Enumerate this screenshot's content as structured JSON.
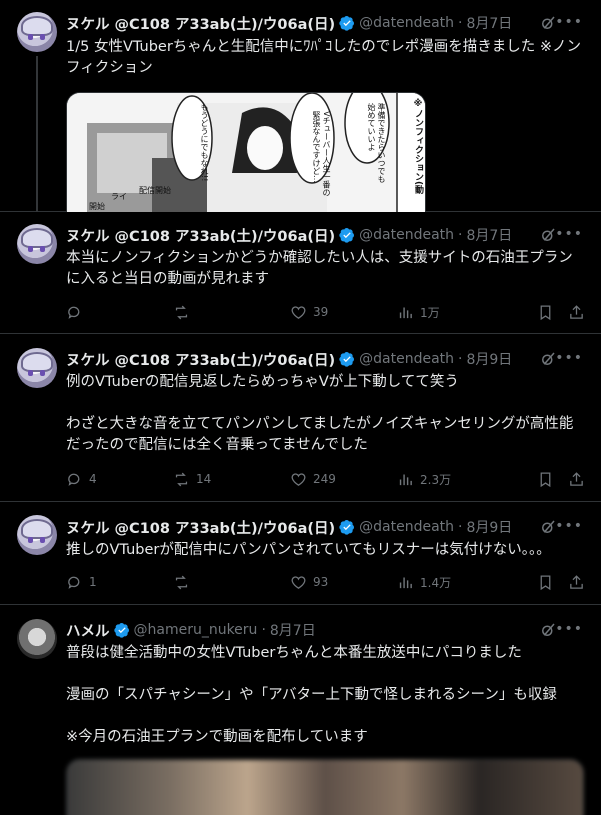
{
  "tweets": [
    {
      "name": "ヌケル @C108 ア33ab(土)/ウ06a(日)",
      "handle": "@datendeath",
      "dot": "·",
      "date": "8月7日",
      "text": "1/5 女性VTuberちゃんと生配信中にﾜﾊﾟｺしたのでレポ漫画を描きました ※ノンフィクション"
    },
    {
      "name": "ヌケル @C108 ア33ab(土)/ウ06a(日)",
      "handle": "@datendeath",
      "dot": "·",
      "date": "8月7日",
      "text": "本当にノンフィクションかどうか確認したい人は、支援サイトの石油王プランに入ると当日の動画が見れます",
      "replies": "",
      "retweets": "",
      "likes": "39",
      "views": "1万"
    },
    {
      "name": "ヌケル @C108 ア33ab(土)/ウ06a(日)",
      "handle": "@datendeath",
      "dot": "·",
      "date": "8月9日",
      "text": "例のVTuberの配信見返したらめっちゃVが上下動してて笑う\n\nわざと大きな音を立ててパンパンしてましたがノイズキャンセリングが高性能だったので配信には全く音乗ってませんでした",
      "replies": "4",
      "retweets": "14",
      "likes": "249",
      "views": "2.3万"
    },
    {
      "name": "ヌケル @C108 ア33ab(土)/ウ06a(日)",
      "handle": "@datendeath",
      "dot": "·",
      "date": "8月9日",
      "text": "推しのVTuberが配信中にパンパンされていてもリスナーは気付けない。。。",
      "replies": "1",
      "retweets": "",
      "likes": "93",
      "views": "1.4万"
    },
    {
      "name": "ハメル",
      "handle": "@hameru_nukeru",
      "dot": "·",
      "date": "8月7日",
      "text": "普段は健全活動中の女性VTuberちゃんと本番生放送中にパコりました\n\n漫画の「スパチャシーン」や「アバター上下動で怪しまれるシーン」も収録\n\n※今月の石油王プランで動画を配布しています"
    }
  ],
  "manga": {
    "bubbles": [
      "準備できたらいつでも始めていいよ",
      "Vチューバー人生一番の緊張なんですけど…",
      "もうどうにでもなれ!!"
    ],
    "side_label": "※ノンフィクション(動",
    "screen_text": [
      "配信開始",
      "ライ",
      "開始"
    ]
  },
  "colors": {
    "verified": "#1d9bf0",
    "muted": "#71767b",
    "border": "#2f3336"
  }
}
